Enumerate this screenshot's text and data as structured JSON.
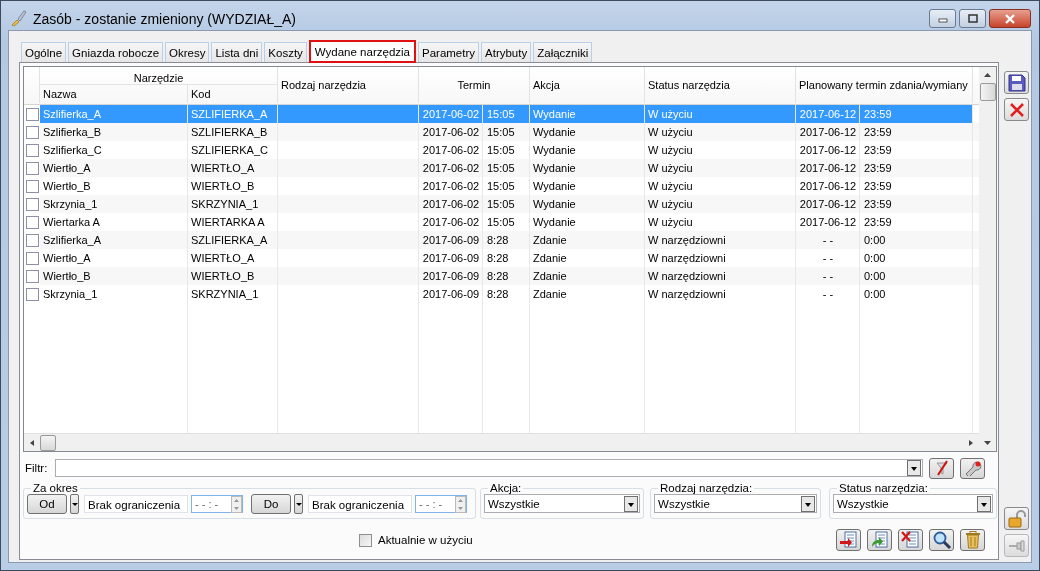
{
  "window": {
    "title": "Zasób - zostanie zmieniony  (WYDZIAŁ_A)"
  },
  "tabs": [
    {
      "label": "Ogólne",
      "selected": false
    },
    {
      "label": "Gniazda robocze",
      "selected": false
    },
    {
      "label": "Okresy",
      "selected": false
    },
    {
      "label": "Lista dni",
      "selected": false
    },
    {
      "label": "Koszty",
      "selected": false
    },
    {
      "label": "Wydane narzędzia",
      "selected": true
    },
    {
      "label": "Parametry",
      "selected": false
    },
    {
      "label": "Atrybuty",
      "selected": false
    },
    {
      "label": "Załączniki",
      "selected": false
    }
  ],
  "table": {
    "group_header": "Narzędzie",
    "columns": [
      "Nazwa",
      "Kod",
      "Rodzaj narzędzia",
      "Termin",
      "Akcja",
      "Status narzędzia",
      "Planowany termin zdania/wymiany"
    ],
    "rows": [
      {
        "name": "Szlifierka_A",
        "code": "SZLIFIERKA_A",
        "date": "2017-06-02",
        "time": "15:05",
        "action": "Wydanie",
        "status": "W użyciu",
        "planned_date": "2017-06-12",
        "planned_time": "23:59",
        "checked": false,
        "selected": true
      },
      {
        "name": "Szlifierka_B",
        "code": "SZLIFIERKA_B",
        "date": "2017-06-02",
        "time": "15:05",
        "action": "Wydanie",
        "status": "W użyciu",
        "planned_date": "2017-06-12",
        "planned_time": "23:59",
        "checked": false,
        "selected": false
      },
      {
        "name": "Szlifierka_C",
        "code": "SZLIFIERKA_C",
        "date": "2017-06-02",
        "time": "15:05",
        "action": "Wydanie",
        "status": "W użyciu",
        "planned_date": "2017-06-12",
        "planned_time": "23:59",
        "checked": false,
        "selected": false
      },
      {
        "name": "Wiertło_A",
        "code": "WIERTŁO_A",
        "date": "2017-06-02",
        "time": "15:05",
        "action": "Wydanie",
        "status": "W użyciu",
        "planned_date": "2017-06-12",
        "planned_time": "23:59",
        "checked": false,
        "selected": false
      },
      {
        "name": "Wiertło_B",
        "code": "WIERTŁO_B",
        "date": "2017-06-02",
        "time": "15:05",
        "action": "Wydanie",
        "status": "W użyciu",
        "planned_date": "2017-06-12",
        "planned_time": "23:59",
        "checked": false,
        "selected": false
      },
      {
        "name": "Skrzynia_1",
        "code": "SKRZYNIA_1",
        "date": "2017-06-02",
        "time": "15:05",
        "action": "Wydanie",
        "status": "W użyciu",
        "planned_date": "2017-06-12",
        "planned_time": "23:59",
        "checked": false,
        "selected": false
      },
      {
        "name": "Wiertarka A",
        "code": "WIERTARKA A",
        "date": "2017-06-02",
        "time": "15:05",
        "action": "Wydanie",
        "status": "W użyciu",
        "planned_date": "2017-06-12",
        "planned_time": "23:59",
        "checked": false,
        "selected": false
      },
      {
        "name": "Szlifierka_A",
        "code": "SZLIFIERKA_A",
        "date": "2017-06-09",
        "time": "8:28",
        "action": "Zdanie",
        "status": "W narzędziowni",
        "planned_date": "- -",
        "planned_time": "0:00",
        "checked": false,
        "selected": false
      },
      {
        "name": "Wiertło_A",
        "code": "WIERTŁO_A",
        "date": "2017-06-09",
        "time": "8:28",
        "action": "Zdanie",
        "status": "W narzędziowni",
        "planned_date": "- -",
        "planned_time": "0:00",
        "checked": false,
        "selected": false
      },
      {
        "name": "Wiertło_B",
        "code": "WIERTŁO_B",
        "date": "2017-06-09",
        "time": "8:28",
        "action": "Zdanie",
        "status": "W narzędziowni",
        "planned_date": "- -",
        "planned_time": "0:00",
        "checked": false,
        "selected": false
      },
      {
        "name": "Skrzynia_1",
        "code": "SKRZYNIA_1",
        "date": "2017-06-09",
        "time": "8:28",
        "action": "Zdanie",
        "status": "W narzędziowni",
        "planned_date": "- -",
        "planned_time": "0:00",
        "checked": false,
        "selected": false
      }
    ]
  },
  "filter": {
    "label": "Filtr:"
  },
  "period": {
    "legend": "Za okres",
    "from_button": "Od",
    "from_value": "Brak ograniczenia",
    "from_time": "- - : -",
    "to_button": "Do",
    "to_value": "Brak ograniczenia",
    "to_time": "- - : -"
  },
  "dropdowns": [
    {
      "label": "Akcja:",
      "value": "Wszystkie"
    },
    {
      "label": "Rodzaj narzędzia:",
      "value": "Wszystkie"
    },
    {
      "label": "Status narzędzia:",
      "value": "Wszystkie"
    }
  ],
  "current_checkbox": {
    "label": "Aktualnie w użyciu",
    "checked": false
  }
}
